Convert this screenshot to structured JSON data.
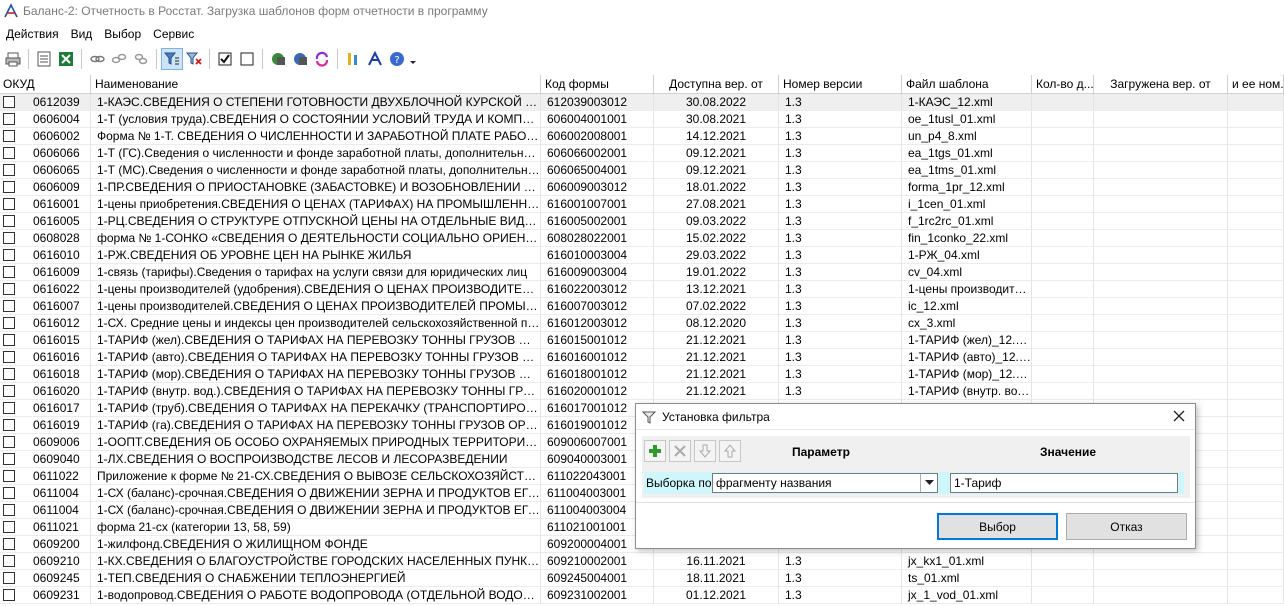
{
  "window": {
    "title": "Баланс-2: Отчетность в Росстат. Загрузка шаблонов форм отчетности в программу",
    "app_icon": "balance-app-icon"
  },
  "menu": {
    "items": [
      "Действия",
      "Вид",
      "Выбор",
      "Сервис"
    ]
  },
  "toolbar": {
    "icons": [
      "print-icon",
      "report-icon",
      "excel-icon",
      "link-icon",
      "unlink-icon",
      "link-all-icon",
      "filter-icon",
      "clear-filter-icon",
      "checkbox-checked-icon",
      "checkbox-empty-icon",
      "download-icon",
      "upload-icon",
      "refresh-icon",
      "settings-icon",
      "font-icon",
      "help-icon"
    ]
  },
  "table": {
    "columns": [
      "ОКУД",
      "Наименование",
      "Код формы",
      "Доступна вер. от",
      "Номер версии",
      "Файл шаблона",
      "Кол-во д...",
      "Загружена вер. от",
      "и ее ном..."
    ],
    "rows": [
      [
        "0612039",
        "1-КАЭС.СВЕДЕНИЯ О СТЕПЕНИ ГОТОВНОСТИ ДВУХБЛОЧНОЙ КУРСКОЙ АЭС-2 ...",
        "612039003012",
        "30.08.2022",
        "1.3",
        "1-КАЭС_12.xml"
      ],
      [
        "0606004",
        "1-Т (условия труда).СВЕДЕНИЯ О СОСТОЯНИИ УСЛОВИЙ ТРУДА И КОМПЕНСАЦ...",
        "606004001001",
        "30.08.2021",
        "1.3",
        "oe_1tusl_01.xml"
      ],
      [
        "0606002",
        "Форма № 1-Т. СВЕДЕНИЯ О ЧИСЛЕННОСТИ И ЗАРАБОТНОЙ ПЛАТЕ РАБОТНИК...",
        "606002008001",
        "14.12.2021",
        "1.3",
        "un_p4_8.xml"
      ],
      [
        "0606066",
        "1-Т (ГС).Сведения о численности и фонде заработной платы, дополнительном проф...",
        "606066002001",
        "09.12.2021",
        "1.3",
        "ea_1tgs_01.xml"
      ],
      [
        "0606065",
        "1-Т (МС).Сведения о численности и фонде заработной платы, дополнительном проф...",
        "606065004001",
        "09.12.2021",
        "1.3",
        "ea_1tms_01.xml"
      ],
      [
        "0606009",
        "1-ПР.СВЕДЕНИЯ О ПРИОСТАНОВКЕ (ЗАБАСТОВКЕ) И ВОЗОБНОВЛЕНИИ РАБОТ...",
        "606009003012",
        "18.01.2022",
        "1.3",
        "forma_1pr_12.xml"
      ],
      [
        "0616001",
        "1-цены приобретения.СВЕДЕНИЯ О ЦЕНАХ (ТАРИФАХ) НА ПРОМЫШЛЕННЫЕ ТО...",
        "616001007001",
        "27.08.2021",
        "1.3",
        "i_1cen_01.xml"
      ],
      [
        "0616005",
        "1-РЦ.СВЕДЕНИЯ О СТРУКТУРЕ ОТПУСКНОЙ ЦЕНЫ НА ОТДЕЛЬНЫЕ ВИДЫ ТО...",
        "616005002001",
        "09.03.2022",
        "1.3",
        "f_1rc2rc_01.xml"
      ],
      [
        "0608028",
        "форма № 1-СОНКО «СВЕДЕНИЯ О ДЕЯТЕЛЬНОСТИ СОЦИАЛЬНО ОРИЕНТИРОВ...",
        "608028022001",
        "15.02.2022",
        "1.3",
        "fin_1conko_22.xml"
      ],
      [
        "0616010",
        "1-РЖ.СВЕДЕНИЯ ОБ УРОВНЕ ЦЕН НА РЫНКЕ ЖИЛЬЯ",
        "616010003004",
        "29.03.2022",
        "1.3",
        "1-РЖ_04.xml"
      ],
      [
        "0616009",
        "1-связь (тарифы).Сведения о тарифах на услуги связи для юридических лиц",
        "616009003004",
        "19.01.2022",
        "1.3",
        "cv_04.xml"
      ],
      [
        "0616022",
        "1-цены производителей (удобрения).СВЕДЕНИЯ О ЦЕНАХ ПРОИЗВОДИТЕЛЕЙ НА...",
        "616022003012",
        "13.12.2021",
        "1.3",
        "1-цены производител..."
      ],
      [
        "0616007",
        "1-цены производителей.СВЕДЕНИЯ О ЦЕНАХ ПРОИЗВОДИТЕЛЕЙ ПРОМЫШЛЕН...",
        "616007003012",
        "07.02.2022",
        "1.3",
        "ic_12.xml"
      ],
      [
        "0616012",
        "1-СХ. Средние цены и индексы цен производителей сельскохозяйственной продук...",
        "616012003012",
        "08.12.2020",
        "1.3",
        "cx_3.xml"
      ],
      [
        "0616015",
        "1-ТАРИФ (жел).СВЕДЕНИЯ О ТАРИФАХ НА ПЕРЕВОЗКУ ТОННЫ ГРУЗОВ ЖЕЛЕ...",
        "616015001012",
        "21.12.2021",
        "1.3",
        "1-ТАРИФ (жел)_12.xml"
      ],
      [
        "0616016",
        "1-ТАРИФ (авто).СВЕДЕНИЯ О ТАРИФАХ НА ПЕРЕВОЗКУ ТОННЫ ГРУЗОВ АВТОМОБИЛЬ...",
        "616016001012",
        "21.12.2021",
        "1.3",
        "1-ТАРИФ (авто)_12.xml"
      ],
      [
        "0616018",
        "1-ТАРИФ (мор).СВЕДЕНИЯ О ТАРИФАХ НА ПЕРЕВОЗКУ ТОННЫ ГРУЗОВ ОРГАН...",
        "616018001012",
        "21.12.2021",
        "1.3",
        "1-ТАРИФ (мор)_12.xml"
      ],
      [
        "0616020",
        "1-ТАРИФ (внутр. вод.).СВЕДЕНИЯ О ТАРИФАХ НА ПЕРЕВОЗКУ ТОННЫ ГРУЗОВ ...",
        "616020001012",
        "21.12.2021",
        "1.3",
        "1-ТАРИФ (внутр. вод...."
      ],
      [
        "0616017",
        "1-ТАРИФ (труб).СВЕДЕНИЯ О ТАРИФАХ НА ПЕРЕКАЧКУ (ТРАНСПОРТИРОВКУ) Г...",
        "616017001012",
        "",
        "",
        ""
      ],
      [
        "0616019",
        "1-ТАРИФ (гa).СВЕДЕНИЯ О ТАРИФАХ НА ПЕРЕВОЗКУ ТОННЫ ГРУЗОВ ОРГАНИ...",
        "616019001012",
        "",
        "",
        ""
      ],
      [
        "0609006",
        "1-ООПТ.СВЕДЕНИЯ ОБ ОСОБО ОХРАНЯЕМЫХ ПРИРОДНЫХ ТЕРРИТОРИЯХ",
        "609006007001",
        "",
        "",
        ""
      ],
      [
        "0609040",
        "1-ЛХ.СВЕДЕНИЯ О ВОСПРОИЗВОДСТВЕ ЛЕСОВ И ЛЕСОРАЗВЕДЕНИИ",
        "609040003001",
        "",
        "",
        ""
      ],
      [
        "0611022",
        "Приложение к форме № 21-СХ.СВЕДЕНИЯ О ВЫВОЗЕ СЕЛЬСКОХОЗЯЙСТВЕННО...",
        "611022043001",
        "",
        "",
        ""
      ],
      [
        "0611004",
        "1-СХ (баланс)-срочная.СВЕДЕНИЯ О ДВИЖЕНИИ ЗЕРНА И ПРОДУКТОВ ЕГО ПЕР...",
        "611004003001",
        "",
        "",
        ""
      ],
      [
        "0611004",
        "1-СХ (баланс)-срочная.СВЕДЕНИЯ О ДВИЖЕНИИ ЗЕРНА И ПРОДУКТОВ ЕГО ПЕР...",
        "611004003004",
        "",
        "",
        ""
      ],
      [
        "0611021",
        "форма 21-сх (категории 13, 58, 59)",
        "611021001001",
        "",
        "",
        ""
      ],
      [
        "0609200",
        "1-жилфонд.СВЕДЕНИЯ О ЖИЛИЩНОМ ФОНДЕ",
        "609200004001",
        "",
        "",
        ""
      ],
      [
        "0609210",
        "1-КХ.СВЕДЕНИЯ О БЛАГОУСТРОЙСТВЕ ГОРОДСКИХ НАСЕЛЕННЫХ ПУНКТОВ",
        "609210002001",
        "16.11.2021",
        "1.3",
        "jx_kx1_01.xml"
      ],
      [
        "0609245",
        "1-ТЕП.СВЕДЕНИЯ О СНАБЖЕНИИ ТЕПЛОЭНЕРГИЕЙ",
        "609245004001",
        "18.11.2021",
        "1.3",
        "ts_01.xml"
      ],
      [
        "0609231",
        "1-водопровод.СВЕДЕНИЯ О РАБОТЕ ВОДОПРОВОДА (ОТДЕЛЬНОЙ ВОДОПРОВО...",
        "609231002001",
        "01.12.2021",
        "1.3",
        "jx_1_vod_01.xml"
      ]
    ]
  },
  "dialog": {
    "title": "Установка фильтра",
    "col_param": "Параметр",
    "col_value": "Значение",
    "row_label": "Выборка по",
    "select_value": "фрагменту названия",
    "input_value": "1-Тариф",
    "ok_label": "Выбор",
    "cancel_label": "Отказ"
  }
}
